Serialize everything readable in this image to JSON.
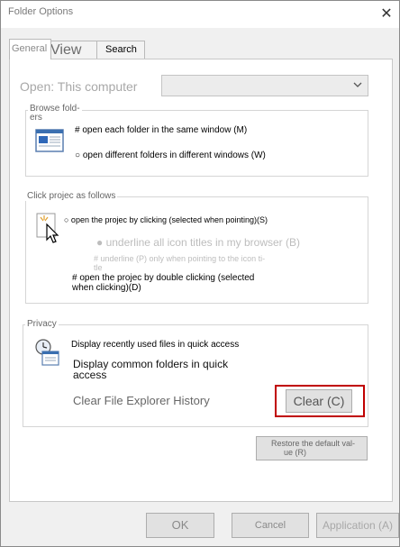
{
  "window": {
    "title": "Folder Options",
    "close_glyph": "✕"
  },
  "tabs": {
    "general": "General",
    "view": "View",
    "search": "Search"
  },
  "open": {
    "label": "Open: This computer",
    "combo_value": ""
  },
  "browse": {
    "title": "Browse fold-",
    "title_line2": "ers",
    "option1": "# open each folder in the same window (M)",
    "option2": "○ open different folders in different windows (W)"
  },
  "click": {
    "title": "Click projec as follows",
    "option1": "○ open the projec by clicking (selected when pointing)(S)",
    "underline_all": "● underline all icon titles in my browser (B)",
    "underline_pointing_1": "# underline (P) only when pointing to the icon ti-",
    "underline_pointing_2": "tle",
    "option2_line1": "# open the projec by double clicking (selected",
    "option2_line2": "when clicking)(D)"
  },
  "privacy": {
    "title": "Privacy",
    "recent_files": "Display recently used files in quick access",
    "common_folders_line1": "Display common folders in quick",
    "common_folders_line2": "access",
    "clear_history": "Clear File Explorer History",
    "clear_button": "Clear (C)"
  },
  "restore": {
    "line1": "Restore the default val-",
    "line2": "ue (R)"
  },
  "footer": {
    "ok": "OK",
    "cancel": "Cancel",
    "apply": "Application (A)"
  },
  "colors": {
    "highlight_red": "#c00000",
    "panel_bg": "#ffffff",
    "window_bg": "#f0f0f0"
  }
}
